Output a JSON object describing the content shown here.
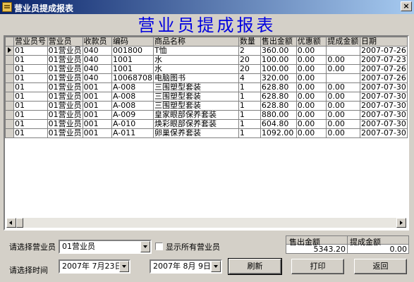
{
  "window": {
    "title": "营业员提成报表",
    "close_glyph": "×"
  },
  "report_title": "营业员提成报表",
  "table": {
    "columns": [
      "营业员号",
      "营业员",
      "收款员",
      "编码",
      "商品名称",
      "数量",
      "售出金额",
      "优惠额",
      "提成金额",
      "日期"
    ],
    "rows": [
      [
        "01",
        "01营业员",
        "040",
        "001800",
        "T恤",
        "2",
        "360.00",
        "0.00",
        "",
        "2007-07-26"
      ],
      [
        "01",
        "01营业员",
        "040",
        "1001",
        "水",
        "20",
        "100.00",
        "0.00",
        "0.00",
        "2007-07-23"
      ],
      [
        "01",
        "01营业员",
        "040",
        "1001",
        "水",
        "20",
        "100.00",
        "0.00",
        "0.00",
        "2007-07-26"
      ],
      [
        "01",
        "01营业员",
        "040",
        "10068708",
        "电脑图书",
        "4",
        "320.00",
        "0.00",
        "",
        "2007-07-26"
      ],
      [
        "01",
        "01营业员",
        "001",
        "A-008",
        "三围塑型套装",
        "1",
        "628.80",
        "0.00",
        "0.00",
        "2007-07-30"
      ],
      [
        "01",
        "01营业员",
        "001",
        "A-008",
        "三围塑型套装",
        "1",
        "628.80",
        "0.00",
        "0.00",
        "2007-07-30"
      ],
      [
        "01",
        "01营业员",
        "001",
        "A-008",
        "三围塑型套装",
        "1",
        "628.80",
        "0.00",
        "0.00",
        "2007-07-30"
      ],
      [
        "01",
        "01营业员",
        "001",
        "A-009",
        "皇家眼部保养套装",
        "1",
        "880.00",
        "0.00",
        "0.00",
        "2007-07-30"
      ],
      [
        "01",
        "01营业员",
        "001",
        "A-010",
        "焕彩眼部保养套装",
        "1",
        "604.80",
        "0.00",
        "0.00",
        "2007-07-30"
      ],
      [
        "01",
        "01营业员",
        "001",
        "A-011",
        "卵巢保养套装",
        "1",
        "1092.00",
        "0.00",
        "0.00",
        "2007-07-30"
      ]
    ]
  },
  "filters": {
    "salesperson_label": "请选择营业员",
    "salesperson_value": "01营业员",
    "show_all_label": "显示所有营业员",
    "show_all_checked": false,
    "time_label": "请选择时间",
    "date_from": "2007年 7月23日",
    "date_to": "2007年 8月 9日"
  },
  "totals": {
    "sales_label": "售出金额",
    "commission_label": "提成金额",
    "sales_value": "5343.20",
    "commission_value": "0.00"
  },
  "buttons": {
    "refresh": "刷新",
    "print": "打印",
    "back": "返回"
  }
}
